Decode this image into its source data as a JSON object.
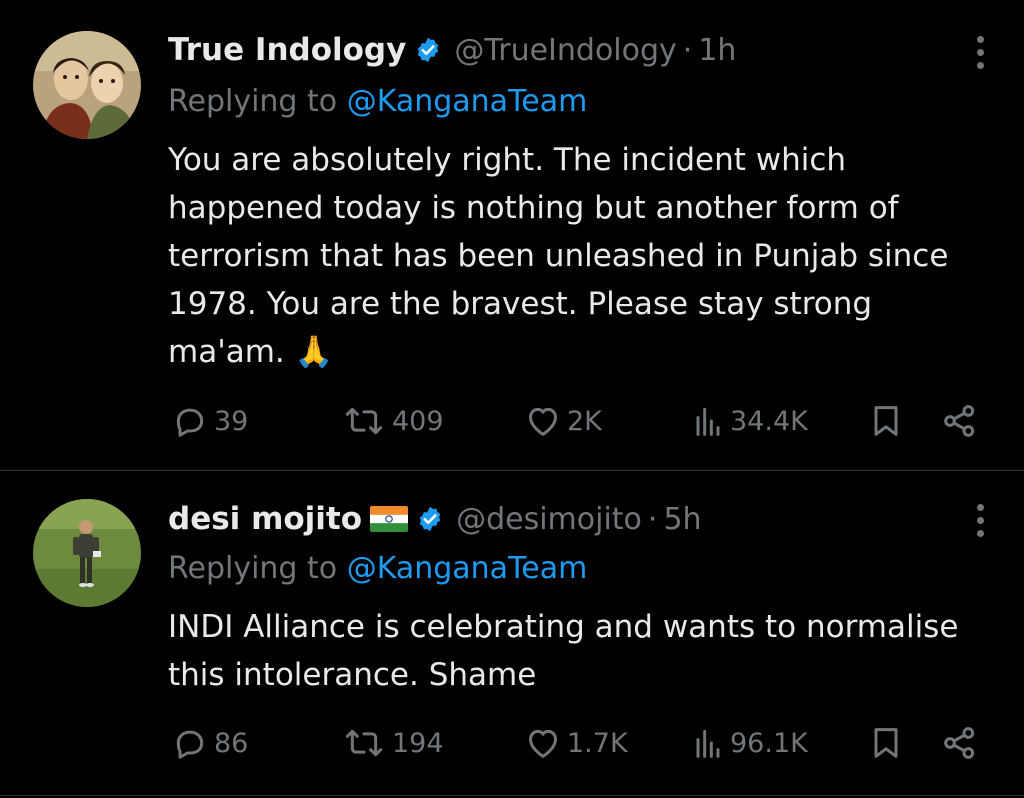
{
  "tweets": [
    {
      "author_name": "True Indology",
      "handle": "@TrueIndology",
      "separator": "·",
      "time": "1h",
      "replying_prefix": "Replying to",
      "replying_to": "@KanganaTeam",
      "text_lines": [
        "You are absolutely right. The incident which",
        "happened today is nothing but another form of",
        "terrorism that has been unleashed in Punjab since",
        "1978. You are the bravest. Please stay strong",
        "ma'am. 🙏"
      ],
      "stats": {
        "replies": "39",
        "reposts": "409",
        "likes": "2K",
        "views": "34.4K"
      },
      "icons": {
        "verified": "verified-badge-icon",
        "more": "more-options-icon"
      }
    },
    {
      "author_name": "desi mojito",
      "flag": "indian-flag-icon",
      "handle": "@desimojito",
      "separator": "·",
      "time": "5h",
      "replying_prefix": "Replying to",
      "replying_to": "@KanganaTeam",
      "text_lines": [
        "INDI Alliance is celebrating and wants to normalise",
        "this intolerance. Shame"
      ],
      "stats": {
        "replies": "86",
        "reposts": "194",
        "likes": "1.7K",
        "views": "96.1K"
      },
      "icons": {
        "verified": "verified-badge-icon",
        "more": "more-options-icon"
      }
    }
  ],
  "colors": {
    "background": "#000000",
    "text": "#e7e9ea",
    "muted": "#71767b",
    "link": "#1d9bf0",
    "divider": "#2f3336"
  }
}
